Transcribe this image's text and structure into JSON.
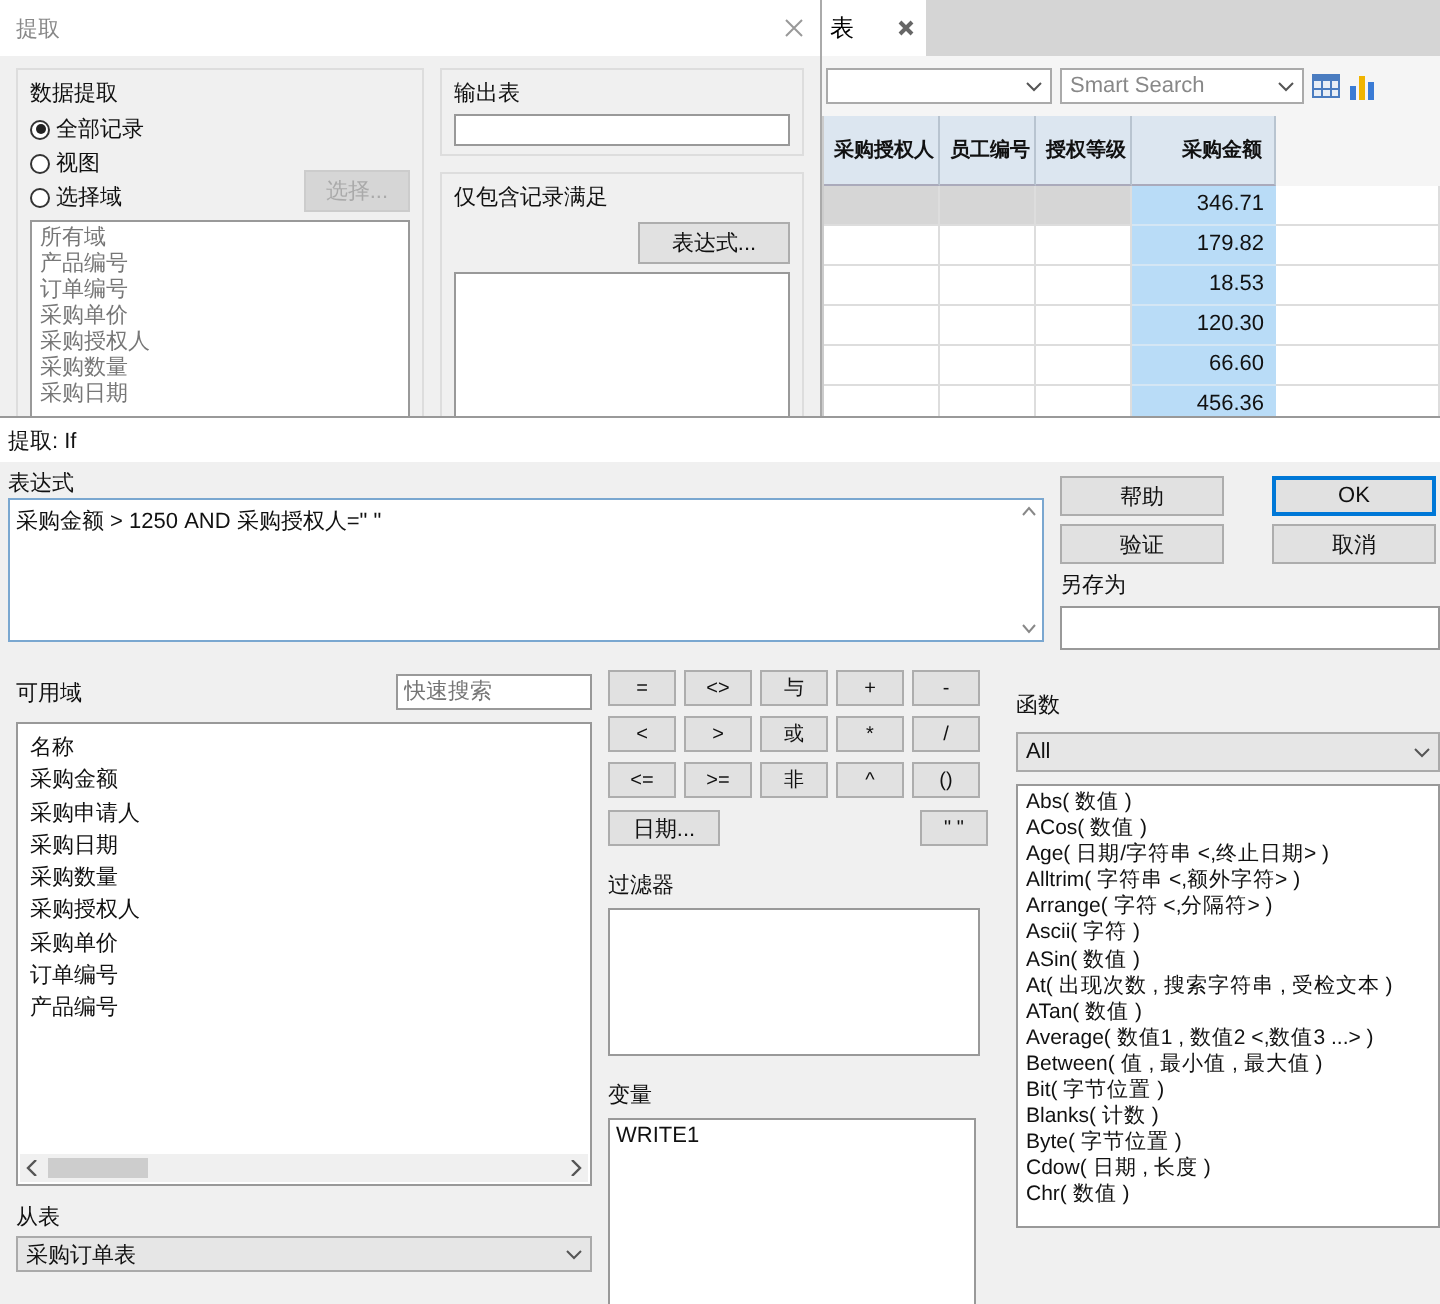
{
  "extract_dialog": {
    "title": "提取",
    "data_extract": {
      "label": "数据提取",
      "options": [
        {
          "label": "全部记录",
          "selected": true
        },
        {
          "label": "视图",
          "selected": false
        },
        {
          "label": "选择域",
          "selected": false
        }
      ],
      "select_button": {
        "label": "选择...",
        "disabled": true
      },
      "fields_disabled": true,
      "fields": [
        "所有域",
        "产品编号",
        "订单编号",
        "采购单价",
        "采购授权人",
        "采购数量",
        "采购日期"
      ]
    },
    "output_table": {
      "label": "输出表"
    },
    "condition": {
      "label": "仅包含记录满足",
      "button": "表达式..."
    }
  },
  "table_view": {
    "tab": {
      "label": "表"
    },
    "search": {
      "placeholder": "Smart Search"
    },
    "columns": [
      "采购授权人",
      "员工编号",
      "授权等级",
      "采购金额"
    ],
    "rows": [
      {
        "amount": "346.71",
        "selected": true
      },
      {
        "amount": "179.82",
        "selected": false
      },
      {
        "amount": "18.53",
        "selected": false
      },
      {
        "amount": "120.30",
        "selected": false
      },
      {
        "amount": "66.60",
        "selected": false
      },
      {
        "amount": "456.36",
        "selected": false
      }
    ]
  },
  "expression_dialog": {
    "title": "提取: If",
    "expression": {
      "label": "表达式",
      "value": "采购金额 > 1250  AND 采购授权人=\" \""
    },
    "buttons": [
      {
        "label": "帮助",
        "default": false
      },
      {
        "label": "OK",
        "default": true
      },
      {
        "label": "验证",
        "default": false
      },
      {
        "label": "取消",
        "default": false
      }
    ],
    "save_as": {
      "label": "另存为"
    },
    "available_fields": {
      "label": "可用域",
      "search_placeholder": "快速搜索",
      "header": "名称",
      "items": [
        "采购金额",
        "采购申请人",
        "采购日期",
        "采购数量",
        "采购授权人",
        "采购单价",
        "订单编号",
        "产品编号"
      ]
    },
    "from_table": {
      "label": "从表",
      "value": "采购订单表"
    },
    "operators": [
      [
        "=",
        "<>",
        "与",
        "+",
        "-"
      ],
      [
        "<",
        ">",
        "或",
        "*",
        "/"
      ],
      [
        "<=",
        ">=",
        "非",
        "^",
        "()"
      ]
    ],
    "date_button": "日期...",
    "quote_button": "\" \"",
    "filter": {
      "label": "过滤器"
    },
    "variables": {
      "label": "变量",
      "items": [
        "WRITE1"
      ]
    },
    "functions": {
      "label": "函数",
      "category": "All",
      "items": [
        "Abs( 数值 )",
        "ACos( 数值 )",
        "Age( 日期/字符串 <,终止日期> )",
        "Alltrim( 字符串 <,额外字符> )",
        "Arrange( 字符 <,分隔符> )",
        "Ascii( 字符 )",
        "ASin( 数值 )",
        "At( 出现次数 , 搜索字符串 , 受检文本 )",
        "ATan( 数值 )",
        "Average( 数值1 , 数值2 <,数值3 ...> )",
        "Between( 值 , 最小值 , 最大值 )",
        "Bit( 字节位置 )",
        "Blanks( 计数 )",
        "Byte( 字节位置 )",
        "Cdow( 日期 , 长度 )",
        "Chr( 数值 )"
      ]
    }
  }
}
